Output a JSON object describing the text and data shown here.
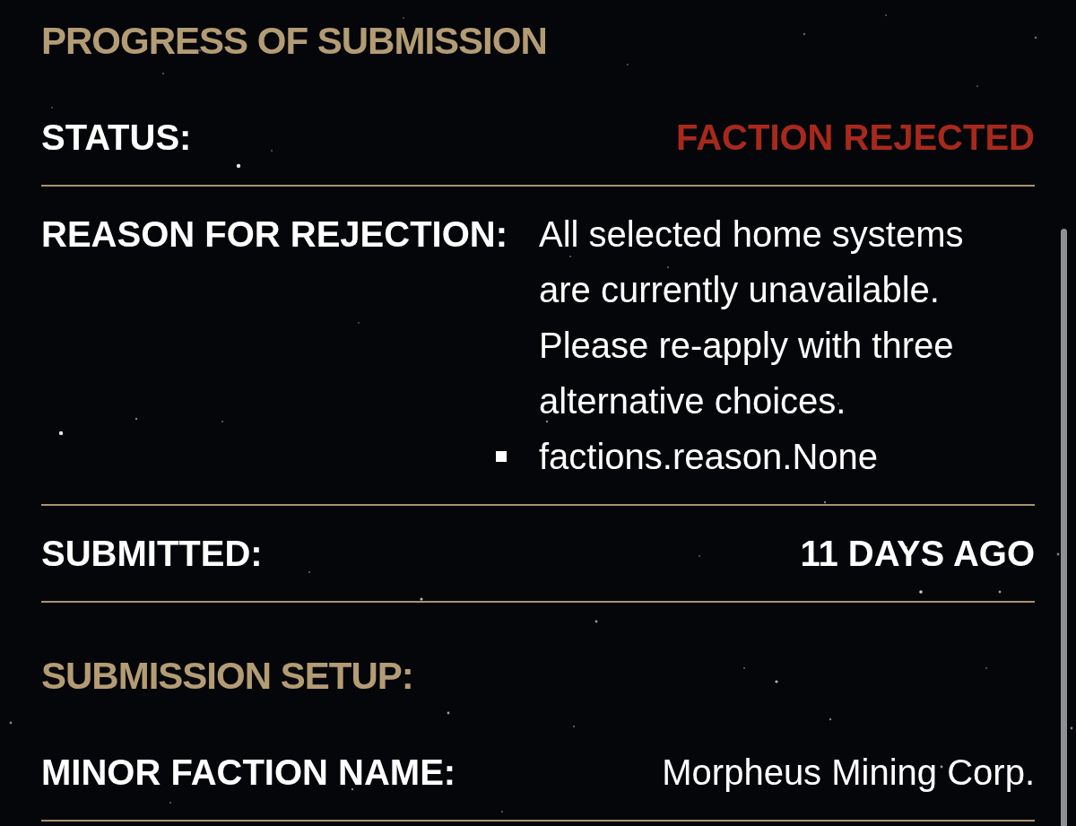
{
  "sections": [
    {
      "title": "PROGRESS OF SUBMISSION",
      "rows": [
        {
          "kind": "status",
          "label": "STATUS:",
          "value": "FACTION REJECTED"
        },
        {
          "kind": "reason",
          "label": "REASON FOR REJECTION:",
          "value": "All selected home systems are currently unavailable. Please re-apply with three alternative choices.",
          "bullets": [
            "factions.reason.None"
          ]
        },
        {
          "kind": "plain",
          "label": "SUBMITTED:",
          "value": "11 DAYS AGO"
        }
      ]
    },
    {
      "title": "SUBMISSION SETUP:",
      "rows": [
        {
          "kind": "name",
          "label": "MINOR FACTION NAME:",
          "value": "Morpheus Mining Corp."
        }
      ]
    }
  ]
}
